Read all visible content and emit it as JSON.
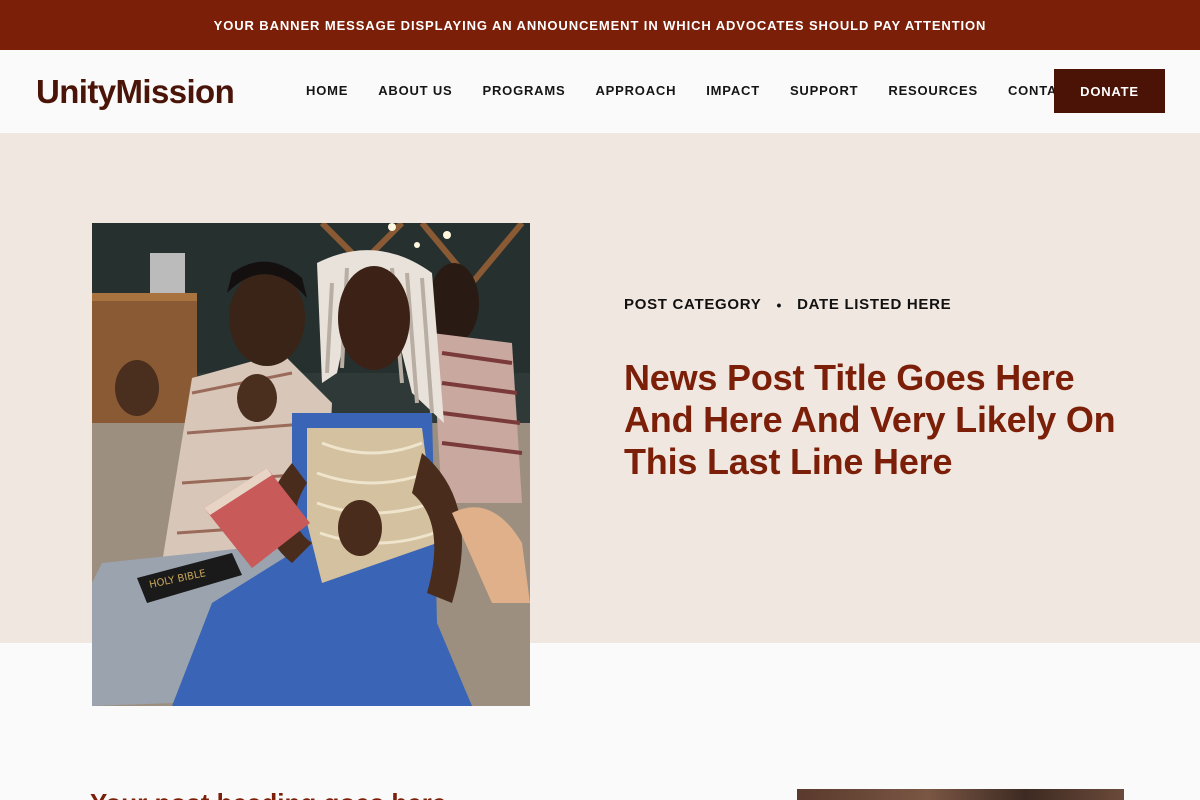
{
  "banner": {
    "message": "YOUR BANNER MESSAGE DISPLAYING AN ANNOUNCEMENT IN WHICH ADVOCATES SHOULD PAY ATTENTION"
  },
  "header": {
    "logo": "UnityMission",
    "nav": [
      "HOME",
      "ABOUT US",
      "PROGRAMS",
      "APPROACH",
      "IMPACT",
      "SUPPORT",
      "RESOURCES",
      "CONTACT"
    ],
    "donate_label": "DONATE"
  },
  "post": {
    "category": "POST CATEGORY",
    "separator": "•",
    "date": "DATE LISTED HERE",
    "title": "News Post Title Goes Here And Here And Very Likely On This Last Line Here",
    "book_text": "HOLY BIBLE"
  },
  "content": {
    "subheading": "Your post heading goes here"
  },
  "colors": {
    "brand": "#7b1f09",
    "donate_bg": "#4a1306",
    "hero_bg": "#f0e7e0",
    "page_bg": "#fafafa"
  }
}
